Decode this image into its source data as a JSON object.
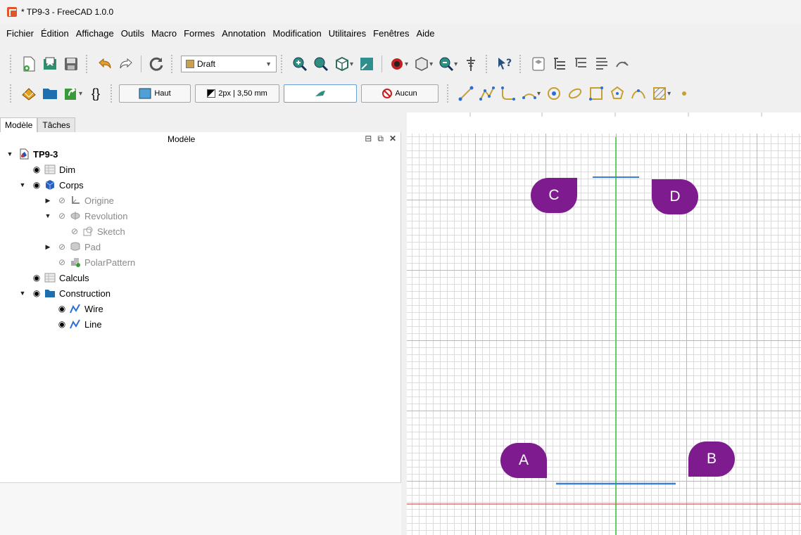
{
  "window": {
    "title": "* TP9-3 - FreeCAD 1.0.0"
  },
  "menu": [
    "Fichier",
    "Édition",
    "Affichage",
    "Outils",
    "Macro",
    "Formes",
    "Annotation",
    "Modification",
    "Utilitaires",
    "Fenêtres",
    "Aide"
  ],
  "toolbar1": {
    "workbench": "Draft"
  },
  "toolbar2": {
    "view_button": "Haut",
    "linewidth_button": "2px | 3,50 mm",
    "style_button": "Aucun"
  },
  "tabs": [
    "Modèle",
    "Tâches"
  ],
  "model_panel": {
    "title": "Modèle",
    "tree": [
      {
        "label": "TP9-3",
        "bold": true
      },
      {
        "label": "Dim"
      },
      {
        "label": "Corps"
      },
      {
        "label": "Origine"
      },
      {
        "label": "Revolution"
      },
      {
        "label": "Sketch"
      },
      {
        "label": "Pad"
      },
      {
        "label": "PolarPattern"
      },
      {
        "label": "Calculs"
      },
      {
        "label": "Construction"
      },
      {
        "label": "Wire"
      },
      {
        "label": "Line"
      }
    ]
  },
  "viewport": {
    "markers": [
      "A",
      "B",
      "C",
      "D"
    ]
  },
  "colors": {
    "marker": "#7e1c8f",
    "y_axis": "#3cc83c",
    "x_axis": "#e05050",
    "selected_line": "#3a7fd8"
  }
}
